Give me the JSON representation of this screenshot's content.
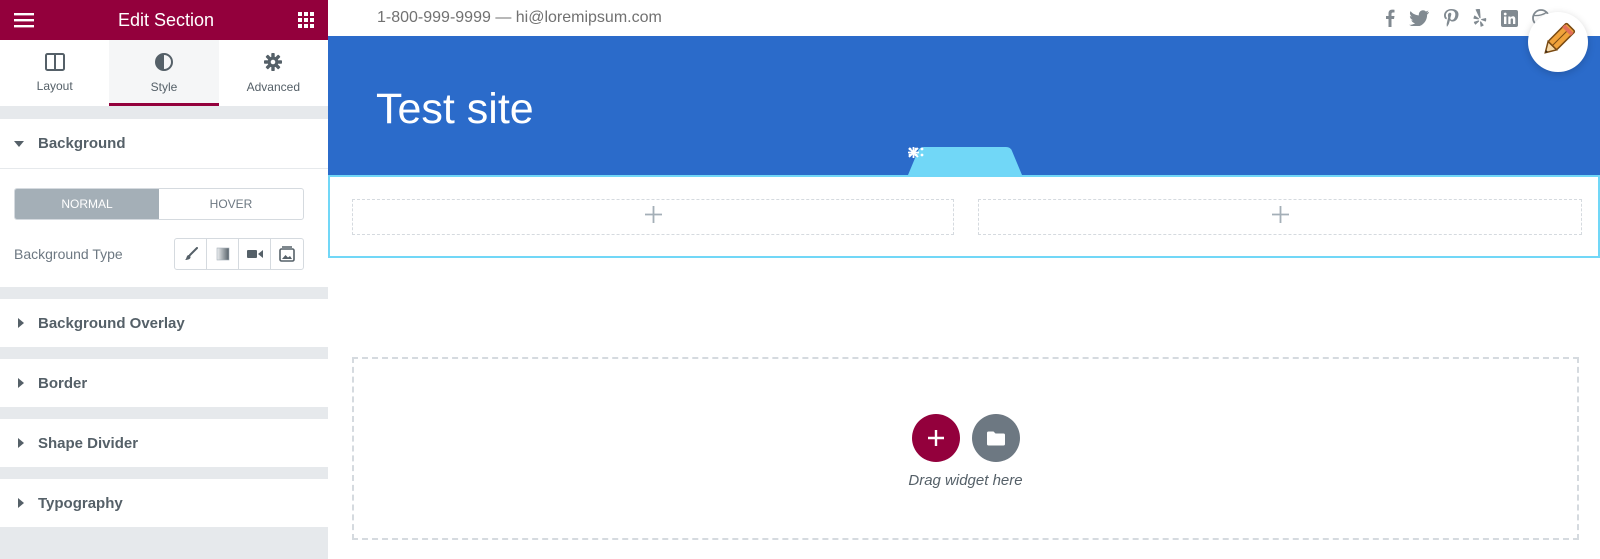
{
  "sidebar": {
    "title": "Edit Section",
    "tabs": [
      {
        "label": "Layout"
      },
      {
        "label": "Style"
      },
      {
        "label": "Advanced"
      }
    ],
    "background": {
      "heading": "Background",
      "state_normal": "NORMAL",
      "state_hover": "HOVER",
      "type_label": "Background Type"
    },
    "sections": [
      {
        "label": "Background Overlay"
      },
      {
        "label": "Border"
      },
      {
        "label": "Shape Divider"
      },
      {
        "label": "Typography"
      }
    ],
    "accent_color": "#93003c"
  },
  "site": {
    "contact": "1-800-999-9999 — hi@loremipsum.com",
    "title": "Test site",
    "hero_color": "#2b6bca",
    "social_icons": [
      "facebook-icon",
      "twitter-icon",
      "pinterest-icon",
      "yelp-icon",
      "linkedin-icon",
      "dribbble-icon"
    ]
  },
  "canvas": {
    "drop_text": "Drag widget here"
  }
}
